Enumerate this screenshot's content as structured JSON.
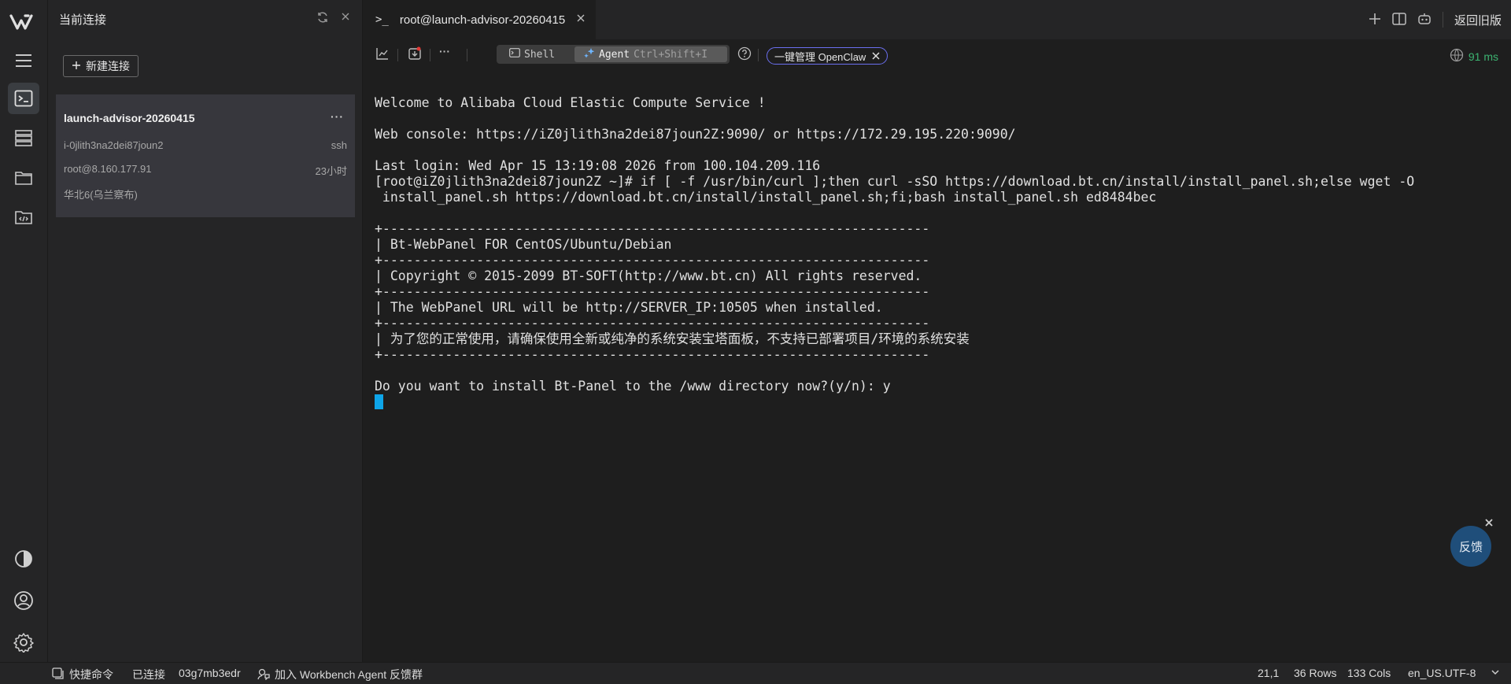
{
  "sidebar": {
    "title": "当前连接",
    "new_connection_label": "新建连接",
    "connection": {
      "name": "launch-advisor-20260415",
      "more": "···",
      "instance_id": "i-0jlith3na2dei87joun2",
      "protocol": "ssh",
      "address": "root@8.160.177.91",
      "age": "23小时",
      "region": "华北6(乌兰察布)"
    }
  },
  "tab": {
    "prompt": ">_",
    "title": "root@launch-advisor-20260415"
  },
  "header": {
    "legacy_label": "返回旧版"
  },
  "toolbar": {
    "more": "···",
    "shell_label": "Shell",
    "agent_label": "Agent",
    "agent_shortcut": "Ctrl+Shift+I",
    "openclaw_label": "一键管理 OpenClaw",
    "latency": "91 ms"
  },
  "terminal": {
    "lines": [
      "Welcome to Alibaba Cloud Elastic Compute Service !",
      "",
      "Web console: https://iZ0jlith3na2dei87joun2Z:9090/ or https://172.29.195.220:9090/",
      "",
      "Last login: Wed Apr 15 13:19:08 2026 from 100.104.209.116",
      "[root@iZ0jlith3na2dei87joun2Z ~]# if [ -f /usr/bin/curl ];then curl -sSO https://download.bt.cn/install/install_panel.sh;else wget -O",
      " install_panel.sh https://download.bt.cn/install/install_panel.sh;fi;bash install_panel.sh ed8484bec",
      "",
      "+----------------------------------------------------------------------",
      "| Bt-WebPanel FOR CentOS/Ubuntu/Debian",
      "+----------------------------------------------------------------------",
      "| Copyright © 2015-2099 BT-SOFT(http://www.bt.cn) All rights reserved.",
      "+----------------------------------------------------------------------",
      "| The WebPanel URL will be http://SERVER_IP:10505 when installed.",
      "+----------------------------------------------------------------------",
      "| 为了您的正常使用，请确保使用全新或纯净的系统安装宝塔面板，不支持已部署项目/环境的系统安装",
      "+----------------------------------------------------------------------",
      "",
      "Do you want to install Bt-Panel to the /www directory now?(y/n): y"
    ]
  },
  "feedback": {
    "label": "反馈"
  },
  "statusbar": {
    "quick_commands": "快捷命令",
    "connected": "已连接",
    "session_id": "03g7mb3edr",
    "join_group": "加入 Workbench Agent 反馈群",
    "cursor_pos": "21,1",
    "rows": "36 Rows",
    "cols": "133 Cols",
    "encoding": "en_US.UTF-8"
  },
  "colors": {
    "accent": "#0ea5e9",
    "latency": "#3cb371",
    "openclaw_border": "#6b6ff0",
    "feedback_bg": "#1f4e7a"
  }
}
